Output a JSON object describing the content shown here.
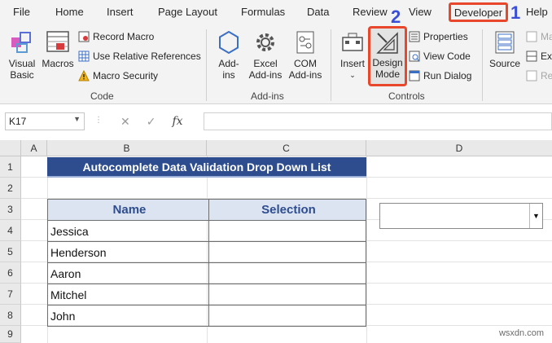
{
  "menu": {
    "tabs": [
      "File",
      "Home",
      "Insert",
      "Page Layout",
      "Formulas",
      "Data",
      "Review",
      "View",
      "Developer",
      "Help"
    ],
    "step1": "1",
    "step2": "2"
  },
  "ribbon": {
    "code": {
      "visual_basic": "Visual\nBasic",
      "macros": "Macros",
      "record_macro": "Record Macro",
      "use_relative": "Use Relative References",
      "macro_security": "Macro Security",
      "label": "Code"
    },
    "addins": {
      "addins": "Add-\nins",
      "excel_addins": "Excel\nAdd-ins",
      "com_addins": "COM\nAdd-ins",
      "label": "Add-ins"
    },
    "controls": {
      "insert": "Insert",
      "design_mode": "Design\nMode",
      "properties": "Properties",
      "view_code": "View Code",
      "run_dialog": "Run Dialog",
      "label": "Controls"
    },
    "xml": {
      "source": "Source",
      "ma": "Ma",
      "exp": "Exp",
      "re": "Re"
    }
  },
  "formula_bar": {
    "name_box": "K17",
    "fx": "fx"
  },
  "sheet": {
    "columns": [
      "A",
      "B",
      "C",
      "D"
    ],
    "rows": [
      "1",
      "2",
      "3",
      "4",
      "5",
      "6",
      "7",
      "8",
      "9"
    ],
    "title": "Autocomplete Data Validation Drop Down List",
    "headers": [
      "Name",
      "Selection"
    ],
    "names": [
      "Jessica",
      "Henderson",
      "Aaron",
      "Mitchel",
      "John"
    ]
  },
  "watermark": "wsxdn.com",
  "colors": {
    "accent_red": "#e8472b",
    "step_blue": "#3a4fd6",
    "title_fill": "#2e4d8e",
    "header_fill": "#dce4f2"
  }
}
